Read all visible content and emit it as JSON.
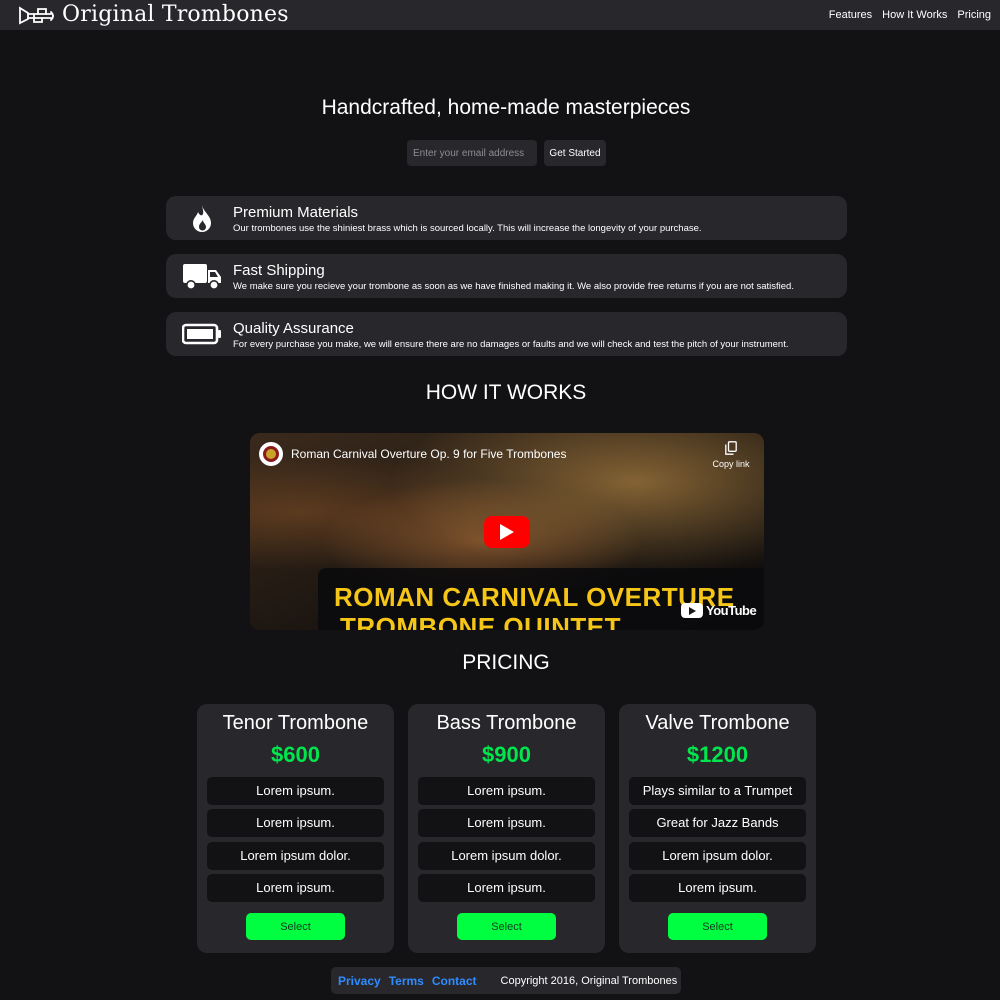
{
  "header": {
    "brand_name": "Original Trombones",
    "logo_icon": "trombone-logo",
    "nav": [
      {
        "label": "Features"
      },
      {
        "label": "How It Works"
      },
      {
        "label": "Pricing"
      }
    ]
  },
  "hero": {
    "title": "Handcrafted, home-made masterpieces",
    "email_placeholder": "Enter your email address",
    "cta_label": "Get Started"
  },
  "features": [
    {
      "icon": "fire-icon",
      "title": "Premium Materials",
      "description": "Our trombones use the shiniest brass which is sourced locally. This will increase the longevity of your purchase."
    },
    {
      "icon": "truck-icon",
      "title": "Fast Shipping",
      "description": "We make sure you recieve your trombone as soon as we have finished making it. We also provide free returns if you are not satisfied."
    },
    {
      "icon": "battery-icon",
      "title": "Quality Assurance",
      "description": "For every purchase you make, we will ensure there are no damages or faults and we will check and test the pitch of your instrument."
    }
  ],
  "how_it_works": {
    "title": "HOW IT WORKS",
    "video": {
      "title": "Roman Carnival Overture Op. 9 for Five Trombones",
      "copy_label": "Copy link",
      "banner_line1": "ROMAN CARNIVAL OVERTURE",
      "banner_line2": "TROMBONE QUINTET",
      "youtube_label": "YouTube"
    }
  },
  "pricing": {
    "title": "PRICING",
    "plans": [
      {
        "name": "Tenor Trombone",
        "price": "$600",
        "features": [
          "Lorem ipsum.",
          "Lorem ipsum.",
          "Lorem ipsum dolor.",
          "Lorem ipsum."
        ],
        "button": "Select"
      },
      {
        "name": "Bass Trombone",
        "price": "$900",
        "features": [
          "Lorem ipsum.",
          "Lorem ipsum.",
          "Lorem ipsum dolor.",
          "Lorem ipsum."
        ],
        "button": "Select"
      },
      {
        "name": "Valve Trombone",
        "price": "$1200",
        "features": [
          "Plays similar to a Trumpet",
          "Great for Jazz Bands",
          "Lorem ipsum dolor.",
          "Lorem ipsum."
        ],
        "button": "Select"
      }
    ]
  },
  "footer": {
    "links": [
      {
        "label": "Privacy"
      },
      {
        "label": "Terms"
      },
      {
        "label": "Contact"
      }
    ],
    "copyright": "Copyright 2016, Original Trombones"
  },
  "colors": {
    "background": "#121214",
    "panel": "#28272c",
    "price_green": "#00e64d",
    "button_green": "#00ff41",
    "link_blue": "#2f8cff",
    "video_text_yellow": "#f5c518",
    "youtube_red": "#ff0000"
  }
}
